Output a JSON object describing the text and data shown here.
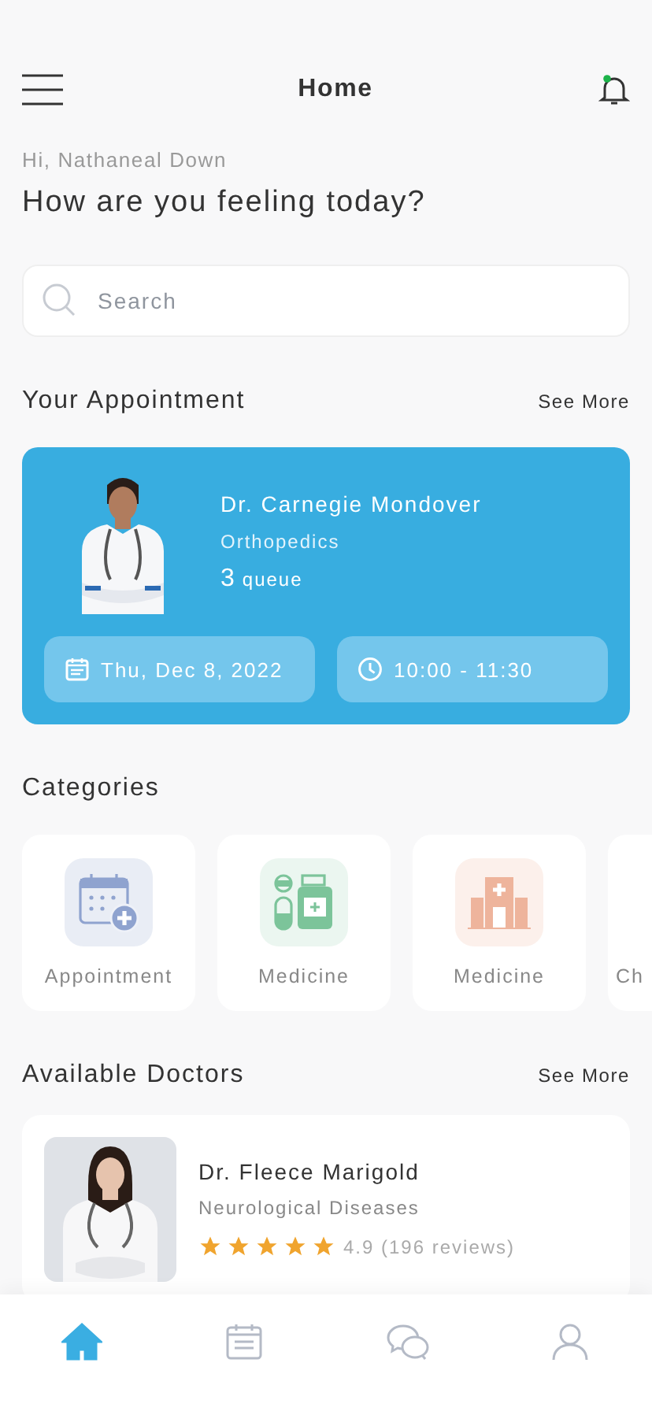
{
  "header": {
    "title": "Home",
    "notification_dot": true
  },
  "greeting": "Hi, Nathaneal Down",
  "heading": "How are you feeling today?",
  "search": {
    "placeholder": "Search"
  },
  "appointment": {
    "title": "Your Appointment",
    "see_more": "See More",
    "doctor": "Dr. Carnegie Mondover",
    "specialty": "Orthopedics",
    "queue_number": "3",
    "queue_label": "queue",
    "date": "Thu, Dec 8, 2022",
    "time": "10:00 - 11:30"
  },
  "categories": {
    "title": "Categories",
    "items": [
      {
        "kind": "calendar",
        "label": "Appointment",
        "color": "#8fa3cf"
      },
      {
        "kind": "medicine",
        "label": "Medicine",
        "color": "#7cc49a"
      },
      {
        "kind": "hospital",
        "label": "Medicine",
        "color": "#eeb49c"
      },
      {
        "kind": "partial",
        "label": "Ch"
      }
    ]
  },
  "doctors": {
    "title": "Available Doctors",
    "see_more": "See More",
    "items": [
      {
        "name": "Dr. Fleece Marigold",
        "specialty": "Neurological Diseases",
        "stars": 5,
        "rating": "4.9 (196 reviews)"
      }
    ]
  },
  "nav": [
    {
      "kind": "home",
      "selected": true
    },
    {
      "kind": "schedule",
      "selected": false
    },
    {
      "kind": "chat",
      "selected": false
    },
    {
      "kind": "profile",
      "selected": false
    }
  ]
}
